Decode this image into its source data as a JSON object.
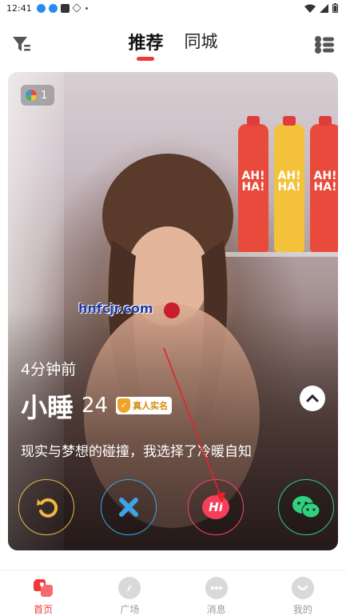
{
  "status_bar": {
    "time": "12:41"
  },
  "header": {
    "tabs": [
      {
        "label": "推荐",
        "active": true
      },
      {
        "label": "同城",
        "active": false
      }
    ]
  },
  "card": {
    "photo_count": "1",
    "watermark": "hnfcjr.com",
    "last_active": "4分钟前",
    "name": "小睡",
    "age": "24",
    "verified_label": "真人实名",
    "bio": "现实与梦想的碰撞，我选择了冷暖自知",
    "bottle_label": "AH! HA!"
  },
  "actions": {
    "hi_label": "Hi"
  },
  "bottom_nav": [
    {
      "label": "首页",
      "icon": "home-icon",
      "active": true
    },
    {
      "label": "广场",
      "icon": "compass-icon",
      "active": false
    },
    {
      "label": "消息",
      "icon": "message-icon",
      "active": false
    },
    {
      "label": "我的",
      "icon": "profile-icon",
      "active": false
    }
  ],
  "colors": {
    "accent": "#f1383d",
    "undo": "#e6b84a",
    "dislike": "#3aa6e8",
    "hi": "#f53f5b",
    "wechat": "#2fd080"
  }
}
